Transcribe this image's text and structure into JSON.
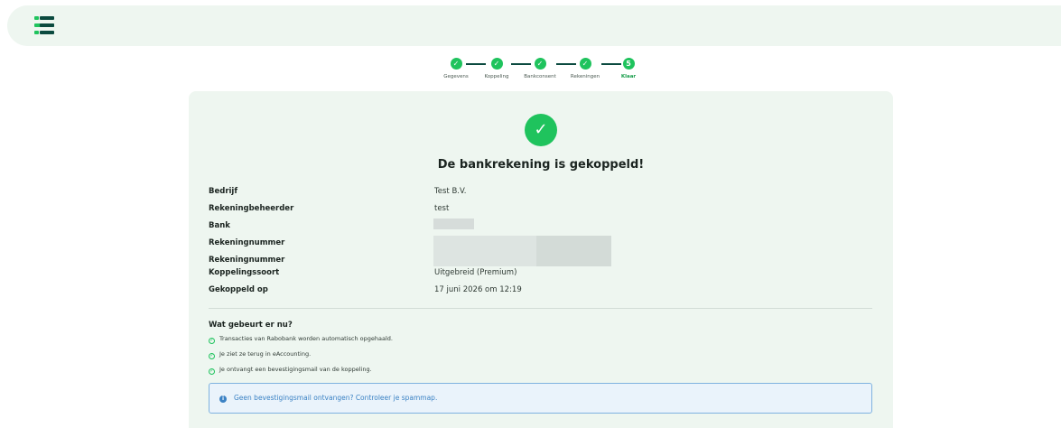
{
  "stepper": {
    "steps": [
      {
        "label": "Gegevens",
        "mark": "✓"
      },
      {
        "label": "Koppeling",
        "mark": "✓"
      },
      {
        "label": "Bankconsent",
        "mark": "✓"
      },
      {
        "label": "Rekeningen",
        "mark": "✓"
      },
      {
        "label": "Klaar",
        "mark": "5"
      }
    ]
  },
  "card": {
    "success_mark": "✓",
    "title": "De bankrekening is gekoppeld!",
    "details": [
      {
        "key": "Bedrijf",
        "value": "Test B.V."
      },
      {
        "key": "Rekeningbeheerder",
        "value": "test"
      },
      {
        "key": "Bank",
        "value": ""
      },
      {
        "key": "Rekeningnummer",
        "value": ""
      },
      {
        "key": "Rekeningnummer",
        "value": ""
      },
      {
        "key": "Koppelingssoort",
        "value": "Uitgebreid (Premium)"
      },
      {
        "key": "Gekoppeld op",
        "value": "17 juni 2026 om 12:19"
      }
    ],
    "next": {
      "title": "Wat gebeurt er nu?",
      "items": [
        "Transacties van Rabobank worden automatisch opgehaald.",
        "Je ziet ze terug in eAccounting.",
        "Je ontvangt een bevestigingsmail van de koppeling."
      ]
    },
    "info": "Geen bevestigingsmail ontvangen? Controleer je spammap."
  },
  "colors": {
    "accent": "#1fc35d",
    "brand_dark": "#0b4a3f",
    "card_bg": "#eef6f0",
    "info": "#3b82c4"
  }
}
